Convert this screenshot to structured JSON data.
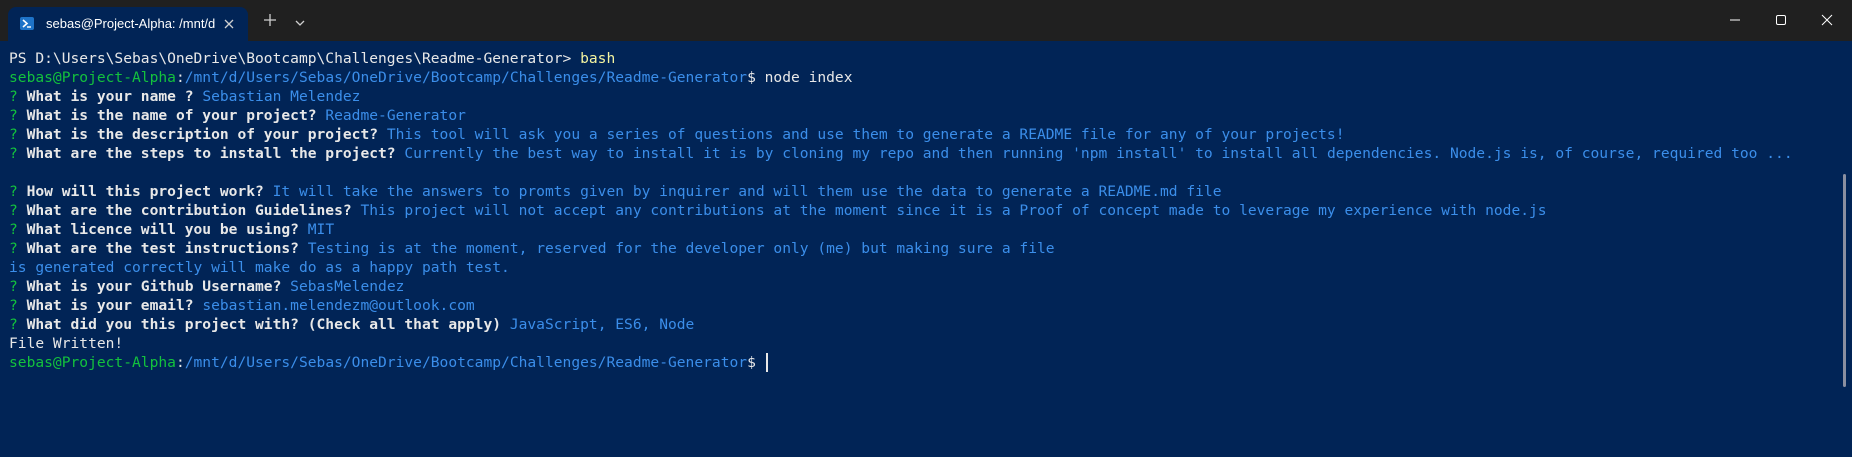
{
  "tab": {
    "title": "sebas@Project-Alpha: /mnt/d"
  },
  "terminal": {
    "ps_line": {
      "prompt": "PS D:\\Users\\Sebas\\OneDrive\\Bootcamp\\Challenges\\Readme-Generator> ",
      "command": "bash"
    },
    "bash_prompt": {
      "user": "sebas@Project-Alpha",
      "path": "/mnt/d/Users/Sebas/OneDrive/Bootcamp/Challenges/Readme-Generator",
      "symbol": "$ "
    },
    "command": "node index",
    "qa": [
      {
        "mark": "? ",
        "question": "What is your name ? ",
        "answer": "Sebastian Melendez"
      },
      {
        "mark": "? ",
        "question": "What is the name of your project? ",
        "answer": "Readme-Generator"
      },
      {
        "mark": "? ",
        "question": "What is the description of your project? ",
        "answer": "This tool will ask you a series of questions and use them to generate a README file for any of your projects!"
      },
      {
        "mark": "? ",
        "question": "What are the steps to install the project? ",
        "answer": "Currently the best way to install it is by cloning my repo and then running 'npm install' to install all dependencies. Node.js is, of course, required too ..."
      },
      {
        "mark": "? ",
        "question": "How will this project work? ",
        "answer": "It will take the answers to promts given by inquirer and will them use the data to generate a README.md file"
      },
      {
        "mark": "? ",
        "question": "What are the contribution Guidelines? ",
        "answer": "This project will not accept any contributions at the moment since it is a Proof of concept made to leverage my experience with node.js"
      },
      {
        "mark": "? ",
        "question": "What licence will you be using? ",
        "answer": "MIT"
      },
      {
        "mark": "? ",
        "question": "What are the test instructions? ",
        "answer": "Testing is at the moment, reserved for the developer only (me) but making sure a file"
      },
      {
        "continuation": "is generated correctly will make do as a happy path test."
      },
      {
        "mark": "? ",
        "question": "What is your Github Username? ",
        "answer": "SebasMelendez"
      },
      {
        "mark": "? ",
        "question": "What is your email? ",
        "answer": "sebastian.melendezm@outlook.com"
      },
      {
        "mark": "? ",
        "question": "What did you this project with? (Check all that apply) ",
        "answer": "JavaScript, ES6, Node"
      }
    ],
    "result": "File Written!"
  },
  "icons": {
    "tab_icon": "powershell-icon",
    "close": "close-icon",
    "new_tab": "plus-icon",
    "dropdown": "chevron-down-icon",
    "minimize": "minimize-icon",
    "maximize": "maximize-icon",
    "window_close": "window-close-icon"
  },
  "colors": {
    "background": "#012456",
    "titlebar": "#202020",
    "prompt_green": "#13c23d",
    "answer_blue": "#3b8eea",
    "text": "#e8e8e8",
    "command_yellow": "#f5f5a0"
  }
}
